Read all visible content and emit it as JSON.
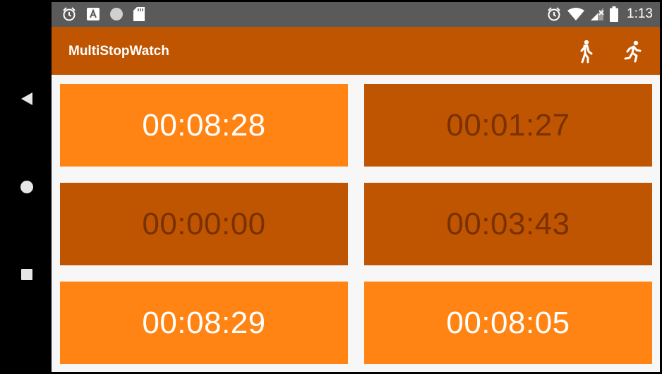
{
  "status_bar": {
    "time": "1:13",
    "left_icons": [
      "alarm-icon",
      "a-badge-icon",
      "circle-icon",
      "sd-card-icon"
    ],
    "right_icons": [
      "alarm-icon",
      "wifi-icon",
      "signal-icon",
      "battery-icon"
    ]
  },
  "app_bar": {
    "title": "MultiStopWatch",
    "actions": [
      "walk-icon",
      "run-icon"
    ]
  },
  "timers": [
    {
      "label": "00:08:28",
      "state": "running"
    },
    {
      "label": "00:01:27",
      "state": "paused"
    },
    {
      "label": "00:00:00",
      "state": "paused"
    },
    {
      "label": "00:03:43",
      "state": "paused"
    },
    {
      "label": "00:08:29",
      "state": "running"
    },
    {
      "label": "00:08:05",
      "state": "running"
    }
  ],
  "colors": {
    "status_bar": "#5a5a5a",
    "app_bar": "#bf5500",
    "running_tile": "#ff8414",
    "paused_tile": "#bf5500",
    "paused_text": "#7a3100",
    "background": "#f7f7f7"
  },
  "nav_bar": {
    "buttons": [
      "back-icon",
      "home-icon",
      "recents-icon"
    ]
  }
}
